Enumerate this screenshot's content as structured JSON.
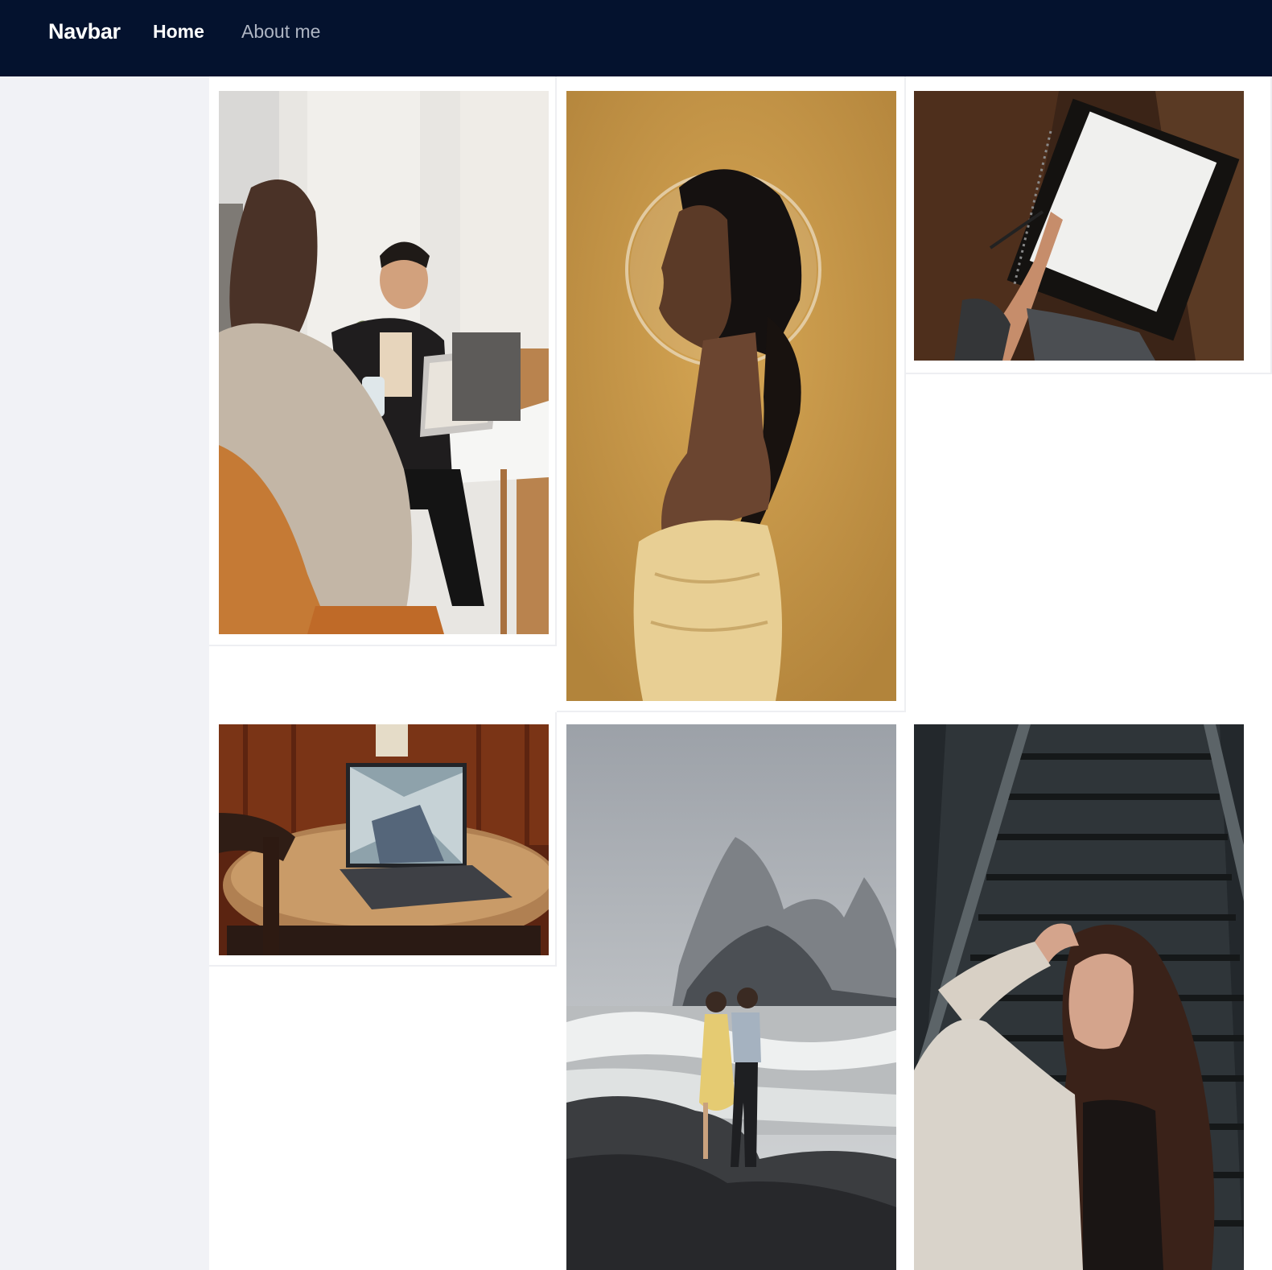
{
  "navbar": {
    "brand": "Navbar",
    "links": [
      {
        "label": "Home",
        "active": true
      },
      {
        "label": "About me",
        "active": false
      }
    ],
    "background_color": "#04122e"
  },
  "gallery": {
    "photos": [
      {
        "subject": "two people meeting at a table with a laptop"
      },
      {
        "subject": "woman with a braid and glass halo on ochre background"
      },
      {
        "subject": "hand with pen over a spiral notebook"
      },
      {
        "subject": "laptop on a round wooden table"
      },
      {
        "subject": "couple embracing on rocks by a misty sea"
      },
      {
        "subject": "woman shading her eyes in front of stairs"
      }
    ]
  }
}
